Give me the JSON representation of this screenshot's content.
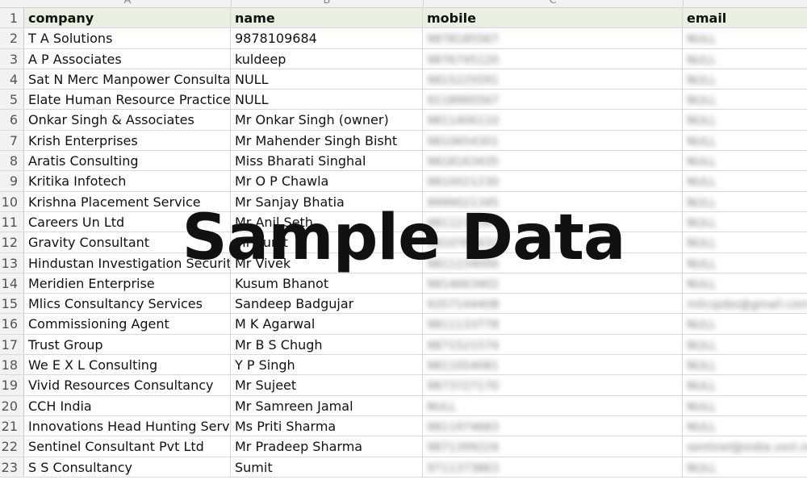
{
  "column_letters": [
    "A",
    "B",
    "C",
    ""
  ],
  "headers": {
    "row_number": "1",
    "company": "company",
    "name": "name",
    "mobile": "mobile",
    "email": "email"
  },
  "rows": [
    {
      "n": "2",
      "company": "T  A Solutions",
      "name": "9878109684",
      "mobile": "9878185567",
      "email": "NULL"
    },
    {
      "n": "3",
      "company": "A P Associates",
      "name": "kuldeep",
      "mobile": "9876745120",
      "email": "NULL"
    },
    {
      "n": "4",
      "company": "Sat N Merc Manpower Consultants",
      "name": "NULL",
      "mobile": "9815225591",
      "email": "NULL"
    },
    {
      "n": "5",
      "company": "Elate Human Resource Practice Pvt Ltd",
      "name": "NULL",
      "mobile": "9218995567",
      "email": "NULL"
    },
    {
      "n": "6",
      "company": "Onkar Singh & Associates",
      "name": "Mr Onkar Singh (owner)",
      "mobile": "9811406110",
      "email": "NULL"
    },
    {
      "n": "7",
      "company": "Krish Enterprises",
      "name": "Mr Mahender Singh Bisht",
      "mobile": "9810654301",
      "email": "NULL"
    },
    {
      "n": "8",
      "company": "Aratis Consulting",
      "name": "Miss Bharati Singhal",
      "mobile": "9818163435",
      "email": "NULL"
    },
    {
      "n": "9",
      "company": "Kritika Infotech",
      "name": "Mr O P Chawla",
      "mobile": "9810021230",
      "email": "NULL"
    },
    {
      "n": "10",
      "company": "Krishna Placement Service",
      "name": "Mr Sanjay Bhatia",
      "mobile": "9999021345",
      "email": "NULL"
    },
    {
      "n": "11",
      "company": "Careers Un Ltd",
      "name": "Mr Anil Seth",
      "mobile": "9811234567",
      "email": "NULL"
    },
    {
      "n": "12",
      "company": "Gravity Consultant",
      "name": "Mr Punit",
      "mobile": "9810765432",
      "email": "NULL"
    },
    {
      "n": "13",
      "company": "Hindustan Investigation  Security Services",
      "name": "Mr Vivek",
      "mobile": "9811234000",
      "email": "NULL"
    },
    {
      "n": "14",
      "company": "Meridien Enterprise",
      "name": "Kusum Bhanot",
      "mobile": "9814663402",
      "email": "NULL"
    },
    {
      "n": "15",
      "company": "Mlics Consultancy Services",
      "name": "Sandeep Badgujar",
      "mobile": "9357144408",
      "email": "mlicsjobs@gmail.com"
    },
    {
      "n": "16",
      "company": "Commissioning Agent",
      "name": "M K Agarwal",
      "mobile": "9811133778",
      "email": "NULL"
    },
    {
      "n": "17",
      "company": "Trust Group",
      "name": "Mr B S Chugh",
      "mobile": "9871521574",
      "email": "NULL"
    },
    {
      "n": "18",
      "company": "We E X L Consulting",
      "name": "Y P Singh",
      "mobile": "9811054081",
      "email": "NULL"
    },
    {
      "n": "19",
      "company": "Vivid Resources Consultancy",
      "name": "Mr Sujeet",
      "mobile": "9873727170",
      "email": "NULL"
    },
    {
      "n": "20",
      "company": "CCH India",
      "name": "Mr Samreen Jamal",
      "mobile": "NULL",
      "email": "NULL"
    },
    {
      "n": "21",
      "company": "Innovations Head Hunting Services",
      "name": "Ms Priti Sharma",
      "mobile": "9811974683",
      "email": "NULL"
    },
    {
      "n": "22",
      "company": "Sentinel Consultant Pvt Ltd",
      "name": "Mr Pradeep Sharma",
      "mobile": "9871399224",
      "email": "sentinel@india.vsnl.net"
    },
    {
      "n": "23",
      "company": "S S Consultancy",
      "name": "Sumit",
      "mobile": "9711373863",
      "email": "NULL"
    }
  ],
  "watermark": "Sample Data"
}
